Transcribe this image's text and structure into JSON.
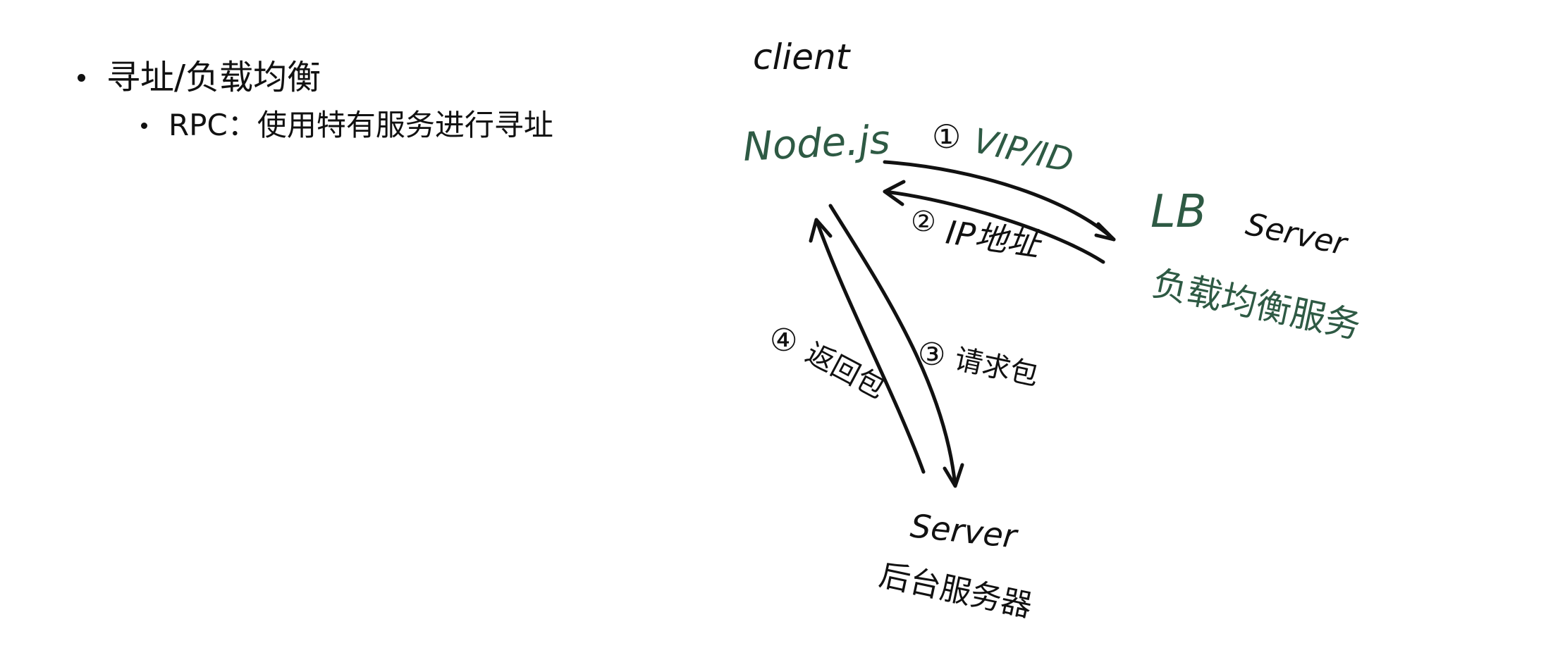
{
  "slide": {
    "bullet1": "寻址/负载均衡",
    "bullet2": "RPC：使用特有服务进行寻址"
  },
  "diagram": {
    "colors": {
      "ink": "#111111",
      "green": "#2e5a44"
    },
    "nodes": {
      "client_label": "client",
      "client_name": "Node.js",
      "lb_name": "LB",
      "lb_label": "Server",
      "lb_desc": "负载均衡服务",
      "backend_label": "Server",
      "backend_desc": "后台服务器"
    },
    "steps": {
      "s1": "①",
      "s1_text": "VIP/ID",
      "s2": "②",
      "s2_text": "IP地址",
      "s3": "③",
      "s3_text": "请求包",
      "s4": "④",
      "s4_text": "返回包"
    }
  }
}
